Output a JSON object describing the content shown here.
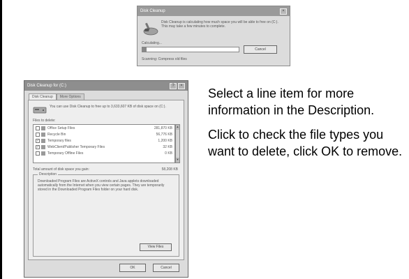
{
  "progress_dialog": {
    "title": "Disk Cleanup",
    "close_glyph": "×",
    "message": "Disk Cleanup is calculating how much space you will be able to free on (C:). This may take a few minutes to complete.",
    "scanning_label": "Calculating...",
    "progress": 0.04,
    "cancel_label": "Cancel",
    "status_text": "Scanning: Compress old files"
  },
  "cleanup_dialog": {
    "title": "Disk Cleanup for (C:)",
    "help_glyph": "?",
    "close_glyph": "×",
    "tabs": [
      "Disk Cleanup",
      "More Options"
    ],
    "intro": "You can use Disk Cleanup to free up to 3,633,607 KB of disk space on (C:).",
    "files_to_delete_label": "Files to delete:",
    "items": [
      {
        "name": "Office Setup Files",
        "size": "281,870 KB",
        "checked": false
      },
      {
        "name": "Recycle Bin",
        "size": "56,776 KB",
        "checked": false
      },
      {
        "name": "Temporary files",
        "size": "1,200 KB",
        "checked": true
      },
      {
        "name": "WebClient/Publisher Temporary Files",
        "size": "32 KB",
        "checked": true
      },
      {
        "name": "Temporary Offline Files",
        "size": "0 KB",
        "checked": false
      }
    ],
    "total_label": "Total amount of disk space you gain:",
    "total_value": "58,208 KB",
    "description_label": "Description",
    "description_text": "Downloaded Program Files are ActiveX controls and Java applets downloaded automatically from the Internet when you view certain pages. They are temporarily stored in the Downloaded Program Files folder on your hard disk.",
    "view_files_label": "View Files",
    "ok_label": "OK",
    "cancel_label": "Cancel"
  },
  "instructions": {
    "p1": "Select a line item for more information in the Description.",
    "p2": "Click to check the file types you want to delete, click OK to remove."
  }
}
